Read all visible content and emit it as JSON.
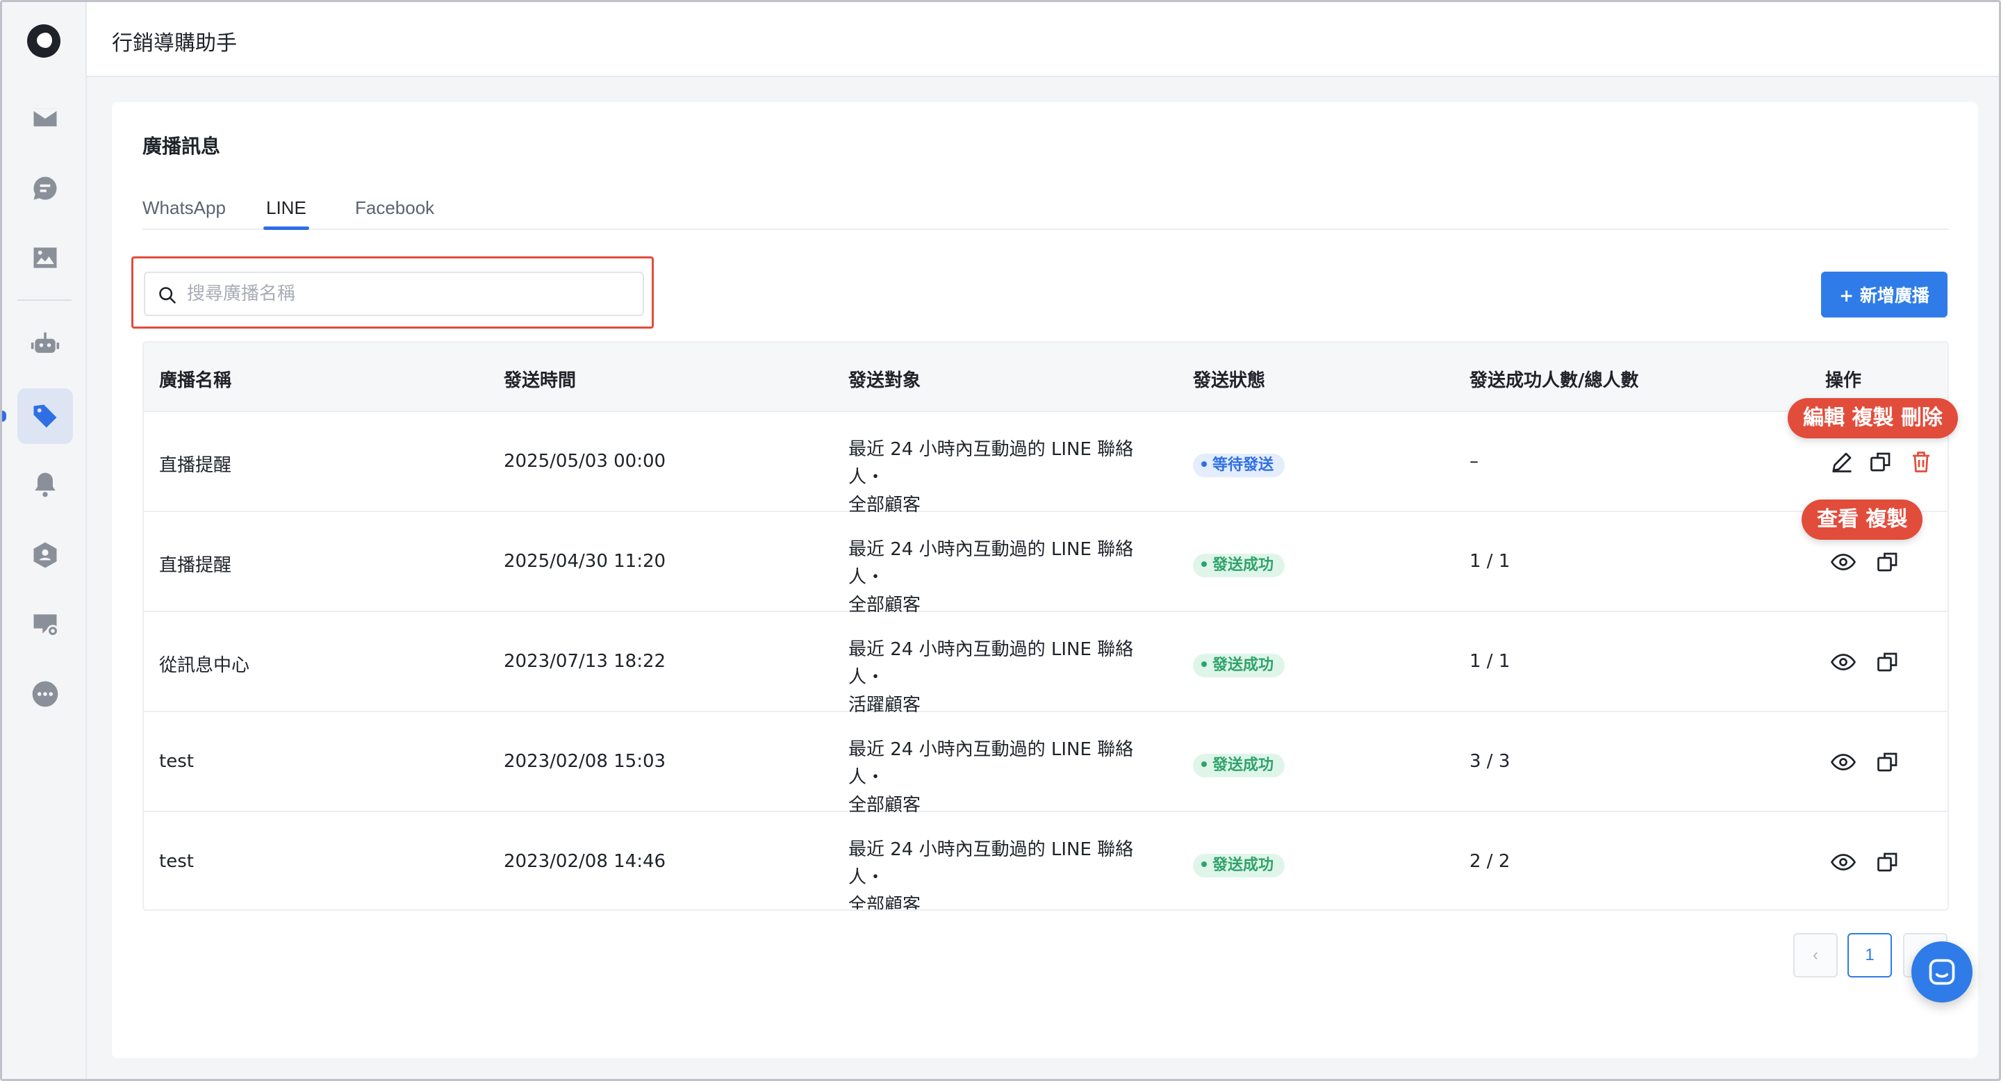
{
  "app": {
    "title": "行銷導購助手"
  },
  "sidebar": {
    "items": [
      {
        "name": "mail-icon"
      },
      {
        "name": "chat-bubble-icon"
      },
      {
        "name": "image-icon"
      },
      {
        "name": "robot-icon"
      },
      {
        "name": "tag-icon",
        "active": true
      },
      {
        "name": "bell-icon"
      },
      {
        "name": "user-badge-icon"
      },
      {
        "name": "message-settings-icon"
      },
      {
        "name": "more-icon"
      }
    ]
  },
  "page": {
    "section_title": "廣播訊息",
    "tabs": [
      {
        "label": "WhatsApp",
        "active": false
      },
      {
        "label": "LINE",
        "active": true
      },
      {
        "label": "Facebook",
        "active": false
      }
    ],
    "search": {
      "placeholder": "搜尋廣播名稱",
      "value": ""
    },
    "add_button": "+ 新增廣播"
  },
  "table": {
    "headers": [
      "廣播名稱",
      "發送時間",
      "發送對象",
      "發送狀態",
      "發送成功人數/總人數",
      "操作"
    ],
    "rows": [
      {
        "name": "直播提醒",
        "time": "2025/05/03 00:00",
        "target_line1": "最近 24 小時內互動過的 LINE 聯絡人・",
        "target_line2": "全部顧客",
        "status": "等待發送",
        "status_type": "pending",
        "count": "–",
        "actions": [
          "edit-icon",
          "copy-icon",
          "trash-icon"
        ]
      },
      {
        "name": "直播提醒",
        "time": "2025/04/30 11:20",
        "target_line1": "最近 24 小時內互動過的 LINE 聯絡人・",
        "target_line2": "全部顧客",
        "status": "發送成功",
        "status_type": "success",
        "count": "1 / 1",
        "actions": [
          "eye-icon",
          "copy-icon"
        ]
      },
      {
        "name": "從訊息中心",
        "time": "2023/07/13 18:22",
        "target_line1": "最近 24 小時內互動過的 LINE 聯絡人・",
        "target_line2": "活躍顧客",
        "status": "發送成功",
        "status_type": "success",
        "count": "1 / 1",
        "actions": [
          "eye-icon",
          "copy-icon"
        ]
      },
      {
        "name": "test",
        "time": "2023/02/08 15:03",
        "target_line1": "最近 24 小時內互動過的 LINE 聯絡人・",
        "target_line2": "全部顧客",
        "status": "發送成功",
        "status_type": "success",
        "count": "3 / 3",
        "actions": [
          "eye-icon",
          "copy-icon"
        ]
      },
      {
        "name": "test",
        "time": "2023/02/08 14:46",
        "target_line1": "最近 24 小時內互動過的 LINE 聯絡人・",
        "target_line2": "全部顧客",
        "status": "發送成功",
        "status_type": "success",
        "count": "2 / 2",
        "actions": [
          "eye-icon",
          "copy-icon"
        ]
      }
    ]
  },
  "annotations": {
    "pending_row_actions": "編輯 複製 刪除",
    "sent_row_actions": "查看  複製"
  },
  "pagination": {
    "prev": "‹",
    "current": "1"
  },
  "colors": {
    "accent": "#2f7ce8",
    "highlight": "#e24c3b",
    "success": "#2ea36a",
    "pending": "#2f6fe4"
  }
}
